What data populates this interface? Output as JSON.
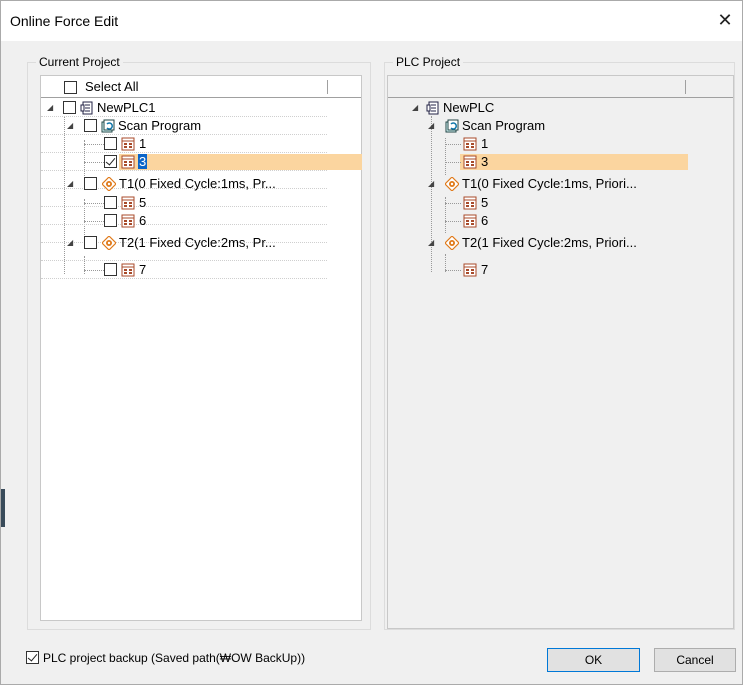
{
  "window": {
    "title": "Online Force Edit",
    "close_glyph": "✕"
  },
  "current_project": {
    "group_label": "Current Project",
    "select_all_label": "Select All",
    "select_all_checked": false,
    "root": "NewPLC1",
    "scan_program": "Scan Program",
    "scan_items": [
      "1",
      "3"
    ],
    "task1": "T1(0 Fixed Cycle:1ms, Pr...",
    "task1_items": [
      "5",
      "6"
    ],
    "task2": "T2(1 Fixed Cycle:2ms, Pr...",
    "task2_items": [
      "7"
    ],
    "checked_item": "3"
  },
  "plc_project": {
    "group_label": "PLC Project",
    "root": "NewPLC",
    "scan_program": "Scan Program",
    "scan_items": [
      "1",
      "3"
    ],
    "task1": "T1(0 Fixed Cycle:1ms, Priori...",
    "task1_items": [
      "5",
      "6"
    ],
    "task2": "T2(1 Fixed Cycle:2ms, Priori...",
    "task2_items": [
      "7"
    ]
  },
  "footer": {
    "backup_label": "PLC project backup (Saved path(₩OW BackUp))",
    "backup_checked": true,
    "ok_label": "OK",
    "cancel_label": "Cancel"
  },
  "colors": {
    "highlight": "#fbd59f",
    "selection": "#0a64c8",
    "program_icon": "#b05030",
    "task_icon": "#e07a1a"
  },
  "icons": {
    "plc": "plc-icon",
    "scan": "scan-program-icon",
    "task": "task-icon",
    "program": "program-icon"
  }
}
